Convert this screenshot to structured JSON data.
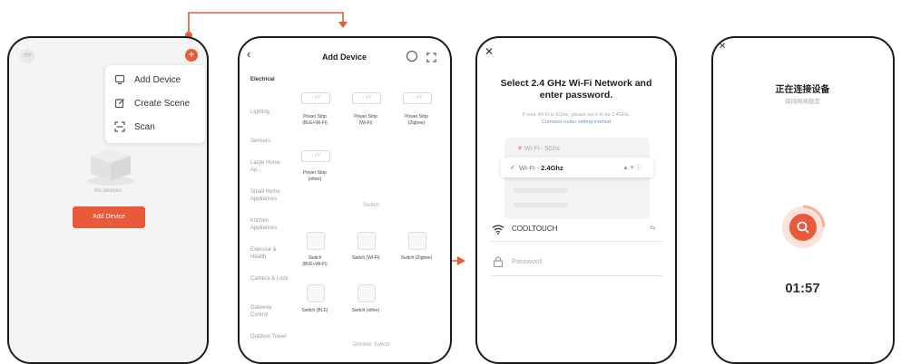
{
  "screen1": {
    "avatar_label": "???",
    "menu": [
      {
        "label": "Add Device",
        "icon": "add-device-icon"
      },
      {
        "label": "Create Scene",
        "icon": "edit-scene-icon"
      },
      {
        "label": "Scan",
        "icon": "scan-icon"
      }
    ],
    "empty_text": "No devices",
    "add_button": "Add Device"
  },
  "screen2": {
    "title": "Add Device",
    "categories": [
      "Electrical",
      "Lighting",
      "Sensors",
      "Large Home Ap...",
      "Small Home Appliances",
      "Kitchen Appliances",
      "Exercise & Health",
      "Camera & Lock",
      "Gateway Control",
      "Outdoor Travel"
    ],
    "strip_text": "~ YY",
    "devices": [
      {
        "label": "Power Strip (BLE+Wi-Fi)"
      },
      {
        "label": "Power Strip (Wi-Fi)"
      },
      {
        "label": "Power Strip (Zigbee)"
      },
      {
        "label": "Power Strip (other)"
      }
    ],
    "switch_section": "Switch",
    "switches": [
      {
        "label": "Switch (BLE+Wi-Fi)"
      },
      {
        "label": "Switch (Wi-Fi)"
      },
      {
        "label": "Switch (Zigbee)"
      },
      {
        "label": "Switch (BLE)"
      },
      {
        "label": "Switch (other)"
      }
    ],
    "bottom_section": "Dimmer Switch"
  },
  "screen3": {
    "title": "Select 2.4 GHz Wi-Fi Network and enter password.",
    "hint": "If your Wi-Fi is 5GHz, please set it to be 2.4GHz.",
    "link": "Common router setting method",
    "wifi_5g": "Wi-Fi - 5Ghz",
    "wifi_24g_prefix": "Wi-Fi - ",
    "wifi_24g_band": "2.4Ghz",
    "ssid": "COOLTOUCH",
    "password_placeholder": "Password"
  },
  "screen4": {
    "title": "正在连接设备",
    "subtitle": "保持网络稳定",
    "timer": "01:57"
  },
  "colors": {
    "accent": "#e85a3a"
  }
}
